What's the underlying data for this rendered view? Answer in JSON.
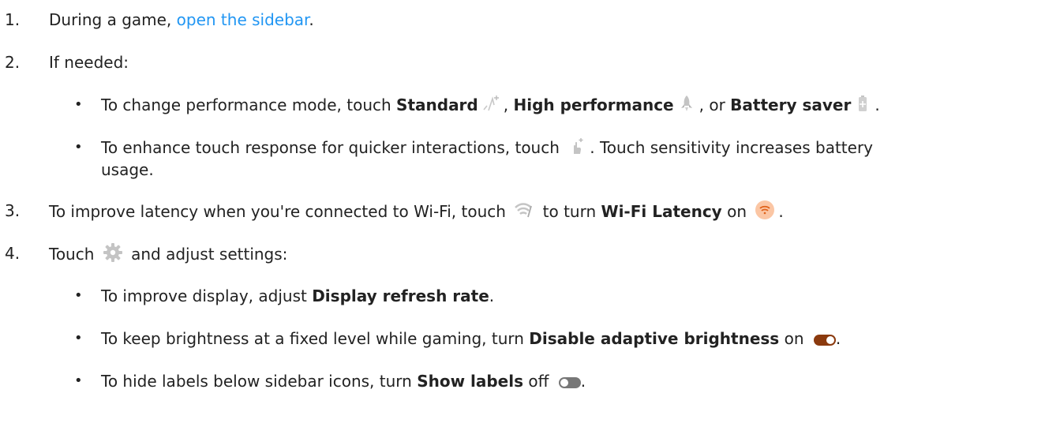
{
  "steps": [
    {
      "num": "1.",
      "pre": "During a game, ",
      "link": "open the sidebar",
      "post": "."
    },
    {
      "num": "2.",
      "text": "If needed:"
    },
    {
      "num": "3.",
      "pre": "To improve latency when you're connected to Wi-Fi, touch ",
      "mid": " to turn ",
      "bold": "Wi-Fi Latency",
      "post": " on ",
      "end": "."
    },
    {
      "num": "4.",
      "pre": "Touch ",
      "post": " and adjust settings:"
    }
  ],
  "step2_bullets": [
    {
      "pre": "To change performance mode, touch ",
      "b1": "Standard",
      "s1": ", ",
      "b2": "High performance",
      "s2": ", or ",
      "b3": "Battery saver",
      "s3": "."
    },
    {
      "pre": "To enhance touch response for quicker interactions, touch ",
      "post": ". Touch sensitivity increases battery",
      "cont": "usage."
    }
  ],
  "step4_bullets": [
    {
      "pre": "To improve display, adjust ",
      "bold": "Display refresh rate",
      "post": "."
    },
    {
      "pre": "To keep brightness at a fixed level while gaming, turn ",
      "bold": "Disable adaptive brightness",
      "post": " on ",
      "end": "."
    },
    {
      "pre": "To hide labels below sidebar icons, turn ",
      "bold": "Show labels",
      "post": " off ",
      "end": "."
    }
  ],
  "bullet_char": "•",
  "colors": {
    "link": "#2196f3",
    "toggle_on": "#8b3a0e",
    "toggle_off": "#777777",
    "wifi_badge": "#fbc6a4"
  },
  "icons": [
    "standard-mode-icon",
    "high-performance-icon",
    "battery-saver-icon",
    "touch-sensitivity-icon",
    "wifi-latency-icon",
    "wifi-latency-on-icon",
    "settings-gear-icon",
    "toggle-on-icon",
    "toggle-off-icon"
  ]
}
